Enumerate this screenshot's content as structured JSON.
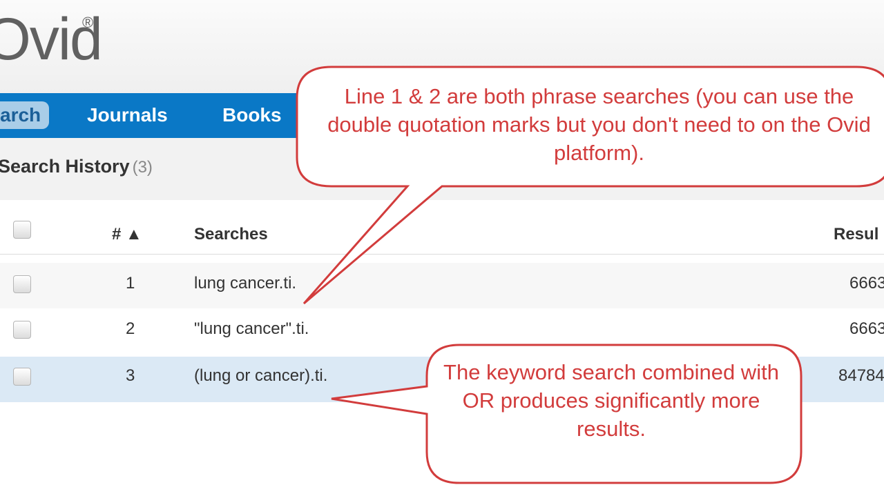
{
  "logo": {
    "text": "Ovid",
    "mark": "®"
  },
  "nav": {
    "tabs": [
      {
        "label": "arch"
      },
      {
        "label": "Journals"
      },
      {
        "label": "Books"
      }
    ]
  },
  "history": {
    "title": "Search History",
    "count": "(3)"
  },
  "table": {
    "columns": {
      "number": "# ▲",
      "searches": "Searches",
      "results": "Resul"
    },
    "rows": [
      {
        "num": "1",
        "search": "lung cancer.ti.",
        "result": "6663"
      },
      {
        "num": "2",
        "search": "\"lung cancer\".ti.",
        "result": "6663"
      },
      {
        "num": "3",
        "search": "(lung or cancer).ti.",
        "result": "84784"
      }
    ]
  },
  "callouts": {
    "top": "Line 1 & 2 are both phrase searches (you can use the double quotation marks but you don't need to on the Ovid platform).",
    "bottom": "The keyword search combined with OR produces significantly more results."
  },
  "colors": {
    "nav": "#0a78c6",
    "callout_border": "#d23c3c",
    "selected_row": "#dbe9f5"
  }
}
